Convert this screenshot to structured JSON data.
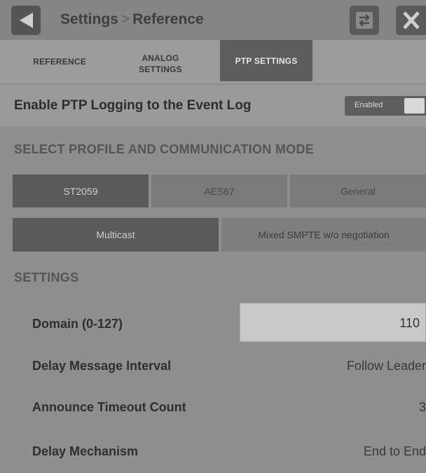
{
  "header": {
    "breadcrumb_parent": "Settings",
    "breadcrumb_separator": ">",
    "breadcrumb_current": "Reference",
    "back_icon": "back-arrow-icon",
    "swap_icon": "swap-arrows-icon",
    "close_icon": "close-x-icon"
  },
  "tabs": [
    {
      "label": "REFERENCE",
      "active": false
    },
    {
      "label": "ANALOG\nSETTINGS",
      "active": false
    },
    {
      "label": "PTP SETTINGS",
      "active": true
    }
  ],
  "logging": {
    "label": "Enable PTP Logging to the Event Log",
    "toggle_text": "Enabled",
    "enabled": true
  },
  "profile_section": {
    "heading": "SELECT PROFILE AND COMMUNICATION MODE",
    "profiles": [
      {
        "label": "ST2059",
        "selected": true
      },
      {
        "label": "AES67",
        "selected": false
      },
      {
        "label": "General",
        "selected": false
      }
    ],
    "modes": [
      {
        "label": "Multicast",
        "selected": true
      },
      {
        "label": "Mixed SMPTE w/o negotiation",
        "selected": false
      }
    ]
  },
  "settings": {
    "heading": "SETTINGS",
    "domain": {
      "label": "Domain (0-127)",
      "value": "110"
    },
    "delay_interval": {
      "label": "Delay Message Interval",
      "value": "Follow Leader"
    },
    "announce_timeout": {
      "label": "Announce Timeout Count",
      "value": "3"
    },
    "delay_mechanism": {
      "label": "Delay Mechanism",
      "value": "End to End"
    }
  },
  "colors": {
    "background": "#8e8e8e",
    "active_tab": "#5d5d5d",
    "selected_segment": "#5a5a5a",
    "unselected_segment": "#7a7a7a"
  }
}
